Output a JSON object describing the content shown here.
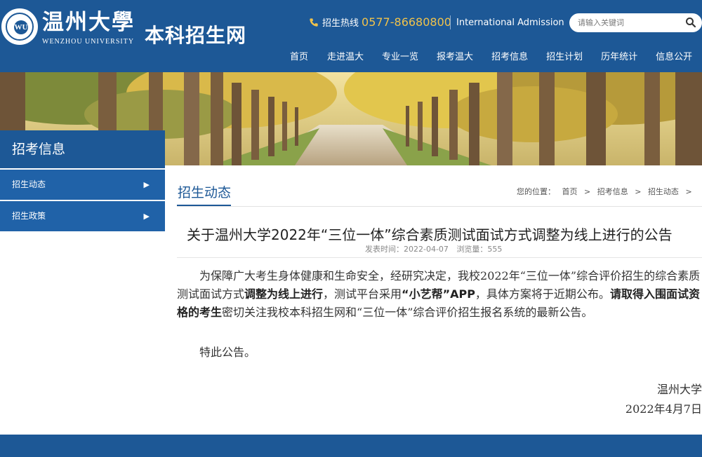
{
  "header": {
    "logo_cn": "温州大學",
    "logo_en": "WENZHOU UNIVERSITY",
    "seal_letters": "WU",
    "site_name": "本科招生网",
    "hotline_label": "招生热线",
    "hotline_number": "0577-86680800",
    "intl_link": "International Admission",
    "search_placeholder": "请输入关键词",
    "nav": [
      "首页",
      "走进温大",
      "专业一览",
      "报考温大",
      "招考信息",
      "招生计划",
      "历年统计",
      "信息公开"
    ]
  },
  "sidebar": {
    "title": "招考信息",
    "items": [
      {
        "label": "招生动态"
      },
      {
        "label": "招生政策"
      }
    ]
  },
  "content": {
    "section_title": "招生动态",
    "breadcrumb": [
      "您的位置：",
      "首页",
      ">",
      "招考信息",
      ">",
      "招生动态",
      ">"
    ],
    "article_title": "关于温州大学2022年“三位一体”综合素质测试面试方式调整为线上进行的公告",
    "publish_label": "发表时间：2022-04-07",
    "views_label": "浏览量：555",
    "p1_a": "为保障广大考生身体健康和生命安全，经研究决定，",
    "p1_b": "我校2022年“三位一体”综合评价招生的综合素质测试面试方式",
    "p1_c": "调整为线上进行",
    "p1_d": "，测试平台采用",
    "p1_e": "“小艺帮”APP",
    "p1_f": "，具体方案将于近期公布。",
    "p1_g": "请取得入围面试资格的考生",
    "p1_h": "密切关注我校本科招生网和“三位一体”综合评价招生报名系统的最新公告。",
    "p2": "特此公告。",
    "signature": "温州大学",
    "date": "2022年4月7日"
  },
  "colors": {
    "primary": "#1d5896",
    "sidebar_item": "#2062a8",
    "hotline_number": "#f0c24b"
  }
}
